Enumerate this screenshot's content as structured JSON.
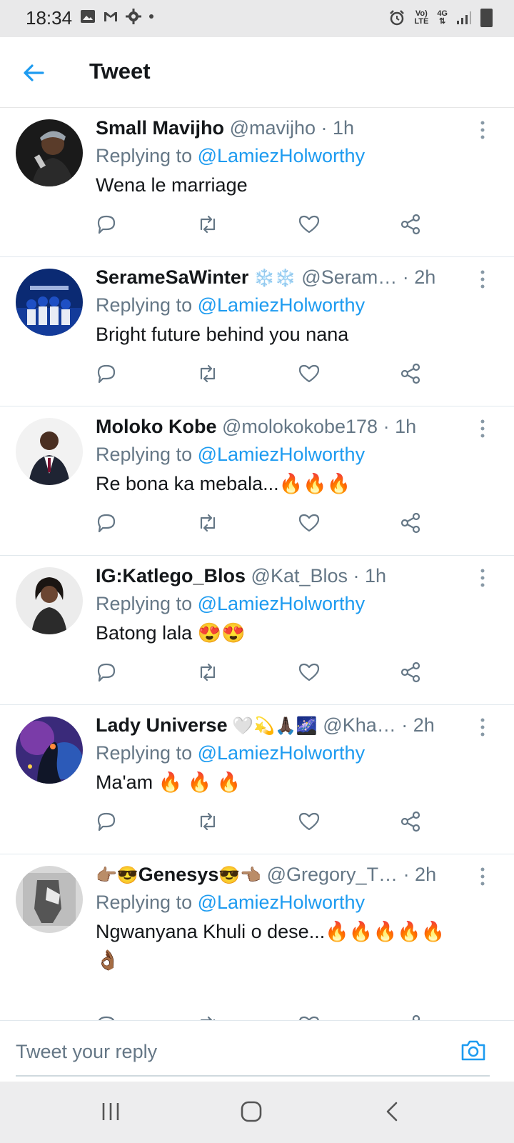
{
  "status_bar": {
    "time": "18:34",
    "signal_label_top": "Vo)",
    "signal_label_bottom": "LTE",
    "network": "4G"
  },
  "header": {
    "title": "Tweet"
  },
  "replies": [
    {
      "name": "Small Mavijho",
      "handle": "@mavijho",
      "time": "· 1h",
      "replying_prefix": "Replying to ",
      "mention": "@LamiezHolworthy",
      "text": "Wena le marriage",
      "name_emojis": ""
    },
    {
      "name": "SerameSaWinter",
      "name_emojis": " ❄️❄️",
      "handle": " @Seram…",
      "time": " · 2h",
      "replying_prefix": "Replying to ",
      "mention": "@LamiezHolworthy",
      "text": "Bright future behind you nana"
    },
    {
      "name": "Moloko Kobe",
      "handle": "@molokokobe178",
      "time": "· 1h",
      "replying_prefix": "Replying to ",
      "mention": "@LamiezHolworthy",
      "text": "Re bona ka mebala...🔥🔥🔥",
      "name_emojis": ""
    },
    {
      "name": "IG:Katlego_Blos",
      "handle": "@Kat_Blos",
      "time": "· 1h",
      "replying_prefix": "Replying to ",
      "mention": "@LamiezHolworthy",
      "text": "Batong lala 😍😍",
      "name_emojis": ""
    },
    {
      "name": "Lady Universe",
      "name_emojis": " 🤍💫🙏🏿🌌",
      "handle": " @Kha…",
      "time": " · 2h",
      "replying_prefix": "Replying to ",
      "mention": "@LamiezHolworthy",
      "text": "Ma'am 🔥 🔥 🔥"
    },
    {
      "name_prefix": "👉🏽😎",
      "name": "Genesys",
      "name_emojis": "😎👈🏽",
      "handle": " @Gregory_T…",
      "time": " · 2h",
      "replying_prefix": "Replying to ",
      "mention": "@LamiezHolworthy",
      "text": "Ngwanyana Khuli o dese...🔥🔥🔥🔥🔥",
      "text_line2": "👌🏾"
    }
  ],
  "composer": {
    "placeholder": "Tweet your reply"
  },
  "icons": {
    "back": "arrow-left-icon",
    "more": "more-vertical-icon",
    "reply": "reply-icon",
    "retweet": "retweet-icon",
    "like": "heart-icon",
    "share": "share-icon",
    "camera": "camera-icon"
  },
  "colors": {
    "accent": "#1d9bf0",
    "muted": "#657786",
    "text": "#14171a"
  }
}
